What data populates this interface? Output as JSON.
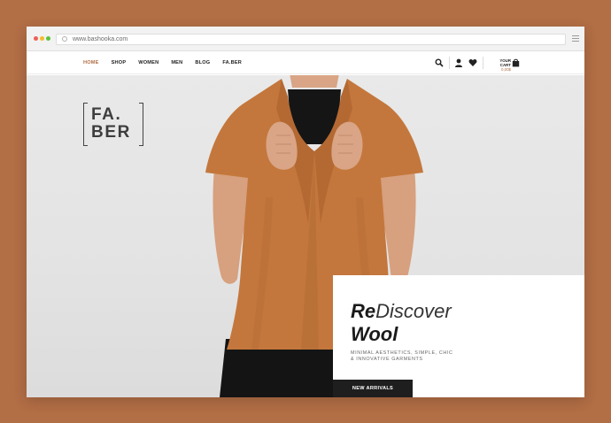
{
  "browser": {
    "url": "www.bashooka.com"
  },
  "nav": {
    "items": [
      {
        "label": "HOME",
        "active": true
      },
      {
        "label": "SHOP",
        "active": false
      },
      {
        "label": "WOMEN",
        "active": false
      },
      {
        "label": "MEN",
        "active": false
      },
      {
        "label": "BLOG",
        "active": false
      },
      {
        "label": "FA.BER",
        "active": false
      }
    ],
    "cart": {
      "label": "YOUR CART",
      "amount": "0,00$"
    }
  },
  "hero": {
    "logo": {
      "line1": "FA.",
      "line2": "BER"
    },
    "headline": {
      "bold1": "Re",
      "light1": "Discover",
      "bold2": "Wool"
    },
    "subtitle": "MINIMAL AESTHETICS, SIMPLE, CHIC & INNOVATIVE GARMENTS",
    "cta_label": "NEW ARRIVALS"
  },
  "colors": {
    "background": "#b26e45",
    "accent": "#b26e45",
    "garment": "#c4773c",
    "dark": "#1e1e1e"
  }
}
